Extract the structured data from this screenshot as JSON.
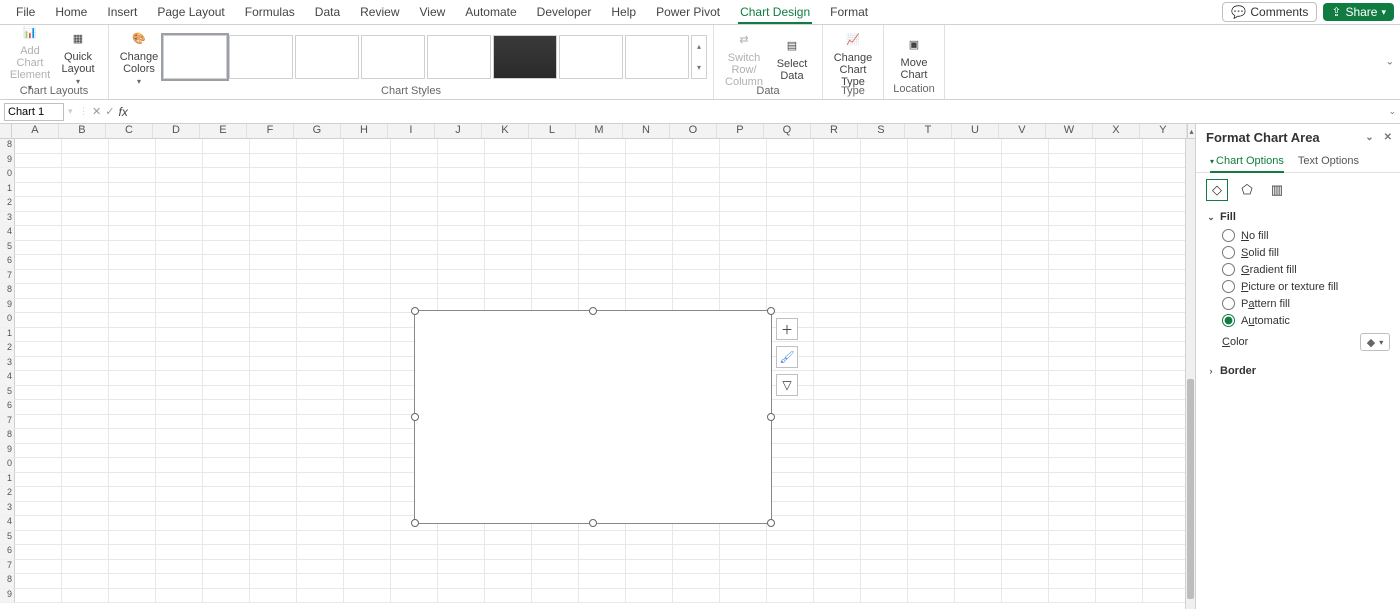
{
  "tabs": {
    "file": "File",
    "home": "Home",
    "insert": "Insert",
    "page_layout": "Page Layout",
    "formulas": "Formulas",
    "data": "Data",
    "review": "Review",
    "view": "View",
    "automate": "Automate",
    "developer": "Developer",
    "help": "Help",
    "power_pivot": "Power Pivot",
    "chart_design": "Chart Design",
    "format": "Format"
  },
  "topright": {
    "comments": "Comments",
    "share": "Share"
  },
  "ribbon": {
    "groups": {
      "chart_layouts": "Chart Layouts",
      "chart_styles": "Chart Styles",
      "data": "Data",
      "type": "Type",
      "location": "Location"
    },
    "buttons": {
      "add_chart_element": "Add Chart\nElement",
      "quick_layout": "Quick\nLayout",
      "change_colors": "Change\nColors",
      "switch_row_col": "Switch Row/\nColumn",
      "select_data": "Select\nData",
      "change_chart_type": "Change\nChart Type",
      "move_chart": "Move\nChart"
    }
  },
  "formula_bar": {
    "namebox_value": "Chart 1",
    "fx": "fx",
    "formula_value": ""
  },
  "grid": {
    "columns": [
      "A",
      "B",
      "C",
      "D",
      "E",
      "F",
      "G",
      "H",
      "I",
      "J",
      "K",
      "L",
      "M",
      "N",
      "O",
      "P",
      "Q",
      "R",
      "S",
      "T",
      "U",
      "V",
      "W",
      "X",
      "Y"
    ],
    "rows": [
      "8",
      "9",
      "0",
      "1",
      "2",
      "3",
      "4",
      "5",
      "6",
      "7",
      "8",
      "9",
      "0",
      "1",
      "2",
      "3",
      "4",
      "5",
      "6",
      "7",
      "8",
      "9",
      "0",
      "1",
      "2",
      "3",
      "4",
      "5",
      "6",
      "7",
      "8",
      "9"
    ]
  },
  "pane": {
    "title": "Format Chart Area",
    "tabs": {
      "chart_options": "Chart Options",
      "text_options": "Text Options"
    },
    "sections": {
      "fill": "Fill",
      "border": "Border"
    },
    "fill_options": {
      "no_fill": "No fill",
      "solid_fill": "Solid fill",
      "gradient_fill": "Gradient fill",
      "picture_texture": "Picture or texture fill",
      "pattern_fill": "Pattern fill",
      "automatic": "Automatic"
    },
    "color_label": "Color"
  },
  "chart_data": {
    "type": "area",
    "title": "",
    "series": [],
    "categories": [],
    "note": "Empty chart object — no data plotted"
  }
}
